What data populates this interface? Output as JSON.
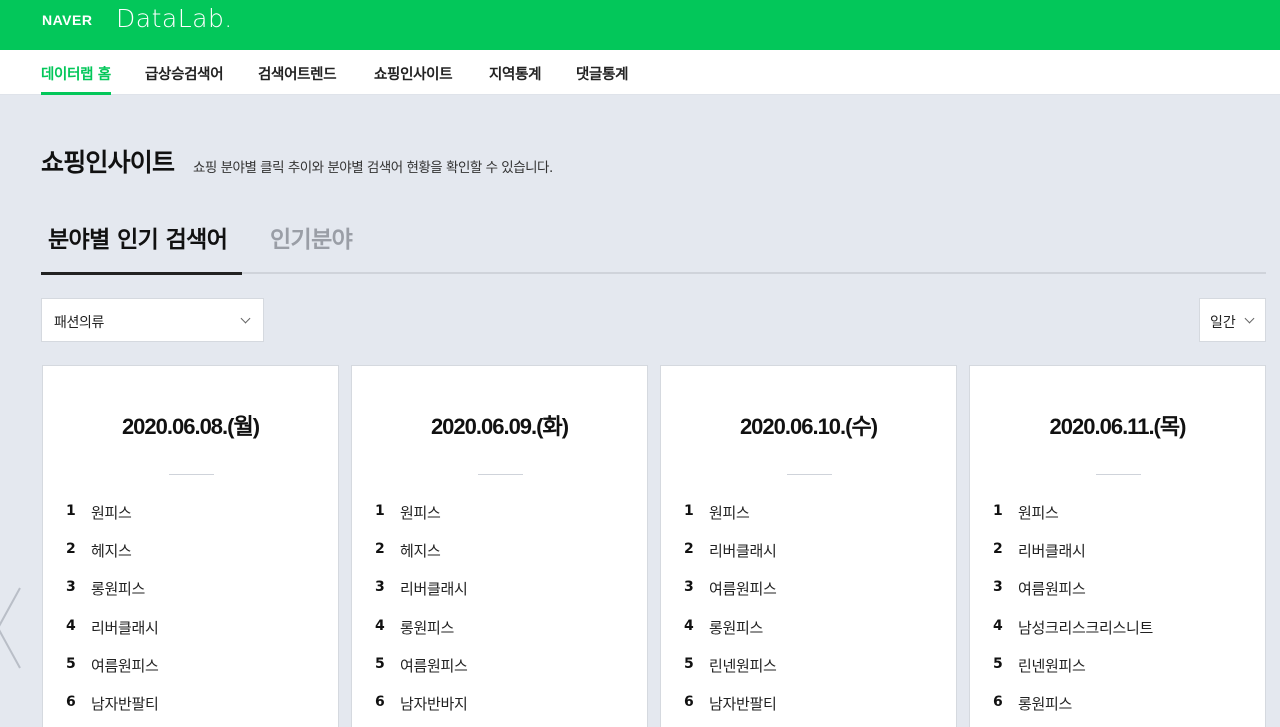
{
  "header": {
    "brand_naver": "NAVER",
    "brand_datalab": "DataLab."
  },
  "nav": {
    "items": [
      {
        "label": "데이터랩 홈"
      },
      {
        "label": "급상승검색어"
      },
      {
        "label": "검색어트렌드"
      },
      {
        "label": "쇼핑인사이트"
      },
      {
        "label": "지역통계"
      },
      {
        "label": "댓글통계"
      }
    ]
  },
  "page": {
    "title": "쇼핑인사이트",
    "description": "쇼핑 분야별 클릭 추이와 분야별 검색어 현황을 확인할 수 있습니다."
  },
  "tabs": [
    {
      "label": "분야별 인기 검색어"
    },
    {
      "label": "인기분야"
    }
  ],
  "filters": {
    "category": "패션의류",
    "period": "일간"
  },
  "cards": [
    {
      "date": "2020.06.08.(월)",
      "items": [
        {
          "rank": "1",
          "keyword": "원피스"
        },
        {
          "rank": "2",
          "keyword": "헤지스"
        },
        {
          "rank": "3",
          "keyword": "롱원피스"
        },
        {
          "rank": "4",
          "keyword": "리버클래시"
        },
        {
          "rank": "5",
          "keyword": "여름원피스"
        },
        {
          "rank": "6",
          "keyword": "남자반팔티"
        }
      ]
    },
    {
      "date": "2020.06.09.(화)",
      "items": [
        {
          "rank": "1",
          "keyword": "원피스"
        },
        {
          "rank": "2",
          "keyword": "헤지스"
        },
        {
          "rank": "3",
          "keyword": "리버클래시"
        },
        {
          "rank": "4",
          "keyword": "롱원피스"
        },
        {
          "rank": "5",
          "keyword": "여름원피스"
        },
        {
          "rank": "6",
          "keyword": "남자반바지"
        }
      ]
    },
    {
      "date": "2020.06.10.(수)",
      "items": [
        {
          "rank": "1",
          "keyword": "원피스"
        },
        {
          "rank": "2",
          "keyword": "리버클래시"
        },
        {
          "rank": "3",
          "keyword": "여름원피스"
        },
        {
          "rank": "4",
          "keyword": "롱원피스"
        },
        {
          "rank": "5",
          "keyword": "린넨원피스"
        },
        {
          "rank": "6",
          "keyword": "남자반팔티"
        }
      ]
    },
    {
      "date": "2020.06.11.(목)",
      "items": [
        {
          "rank": "1",
          "keyword": "원피스"
        },
        {
          "rank": "2",
          "keyword": "리버클래시"
        },
        {
          "rank": "3",
          "keyword": "여름원피스"
        },
        {
          "rank": "4",
          "keyword": "남성크리스크리스니트"
        },
        {
          "rank": "5",
          "keyword": "린넨원피스"
        },
        {
          "rank": "6",
          "keyword": "롱원피스"
        }
      ]
    }
  ],
  "icons": {
    "select_chevron": "chevron-down-icon",
    "prev_arrow": "chevron-left-icon"
  },
  "colors": {
    "brand": "#03c75a",
    "background": "#e4e8ef"
  }
}
